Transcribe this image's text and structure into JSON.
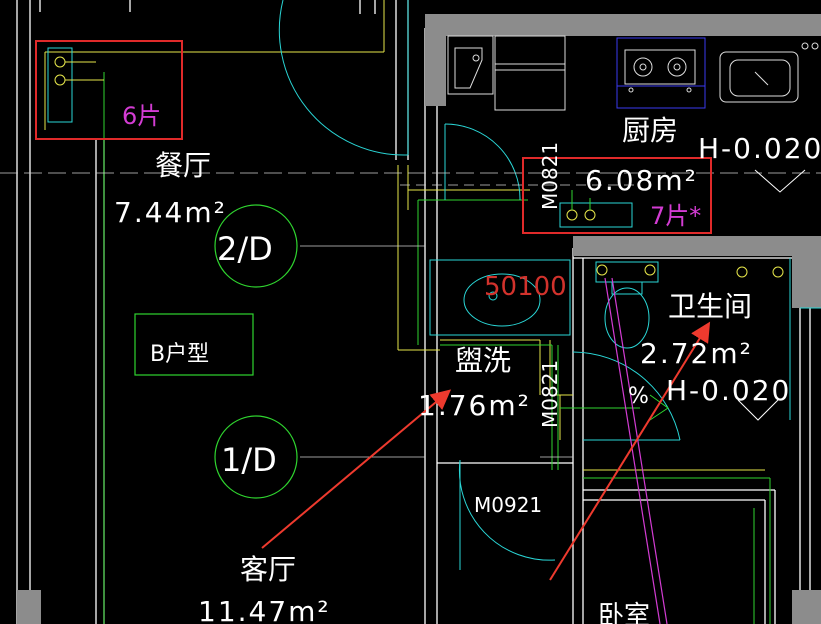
{
  "rooms": {
    "dining": {
      "name": "餐厅",
      "area": "7.44m²"
    },
    "kitchen": {
      "name": "厨房",
      "area": "6.08m²"
    },
    "wash": {
      "name": "盥洗",
      "area": "1.76m²"
    },
    "bathroom": {
      "name": "卫生间",
      "area": "2.72m²"
    },
    "living": {
      "name": "客厅",
      "area": "11.47m²"
    },
    "bedroom": {
      "name": "卧室"
    }
  },
  "elevations": {
    "kitchen": "H-0.020",
    "bathroom": "H-0.020"
  },
  "doors": {
    "kitchen": "M0821",
    "wash": "M0821",
    "bedroom": "M0921"
  },
  "axes": {
    "a1": "2/D",
    "a2": "1/D"
  },
  "unit_type": "B户型",
  "pipe_code": "50100",
  "percent_mark": "%",
  "radiators": {
    "dining": "6片",
    "kitchen": "7片*"
  },
  "colors": {
    "background": "#000000",
    "wall": "#ffffff",
    "yellow_line": "#e6e64a",
    "green_line": "#2fd42f",
    "cyan_line": "#2ad6d6",
    "magenta": "#d33cd3",
    "highlight_box": "#e02a2a",
    "arrow": "#ee3a2e",
    "gray_wall": "#8c8c8c",
    "blue": "#3a3af0"
  }
}
